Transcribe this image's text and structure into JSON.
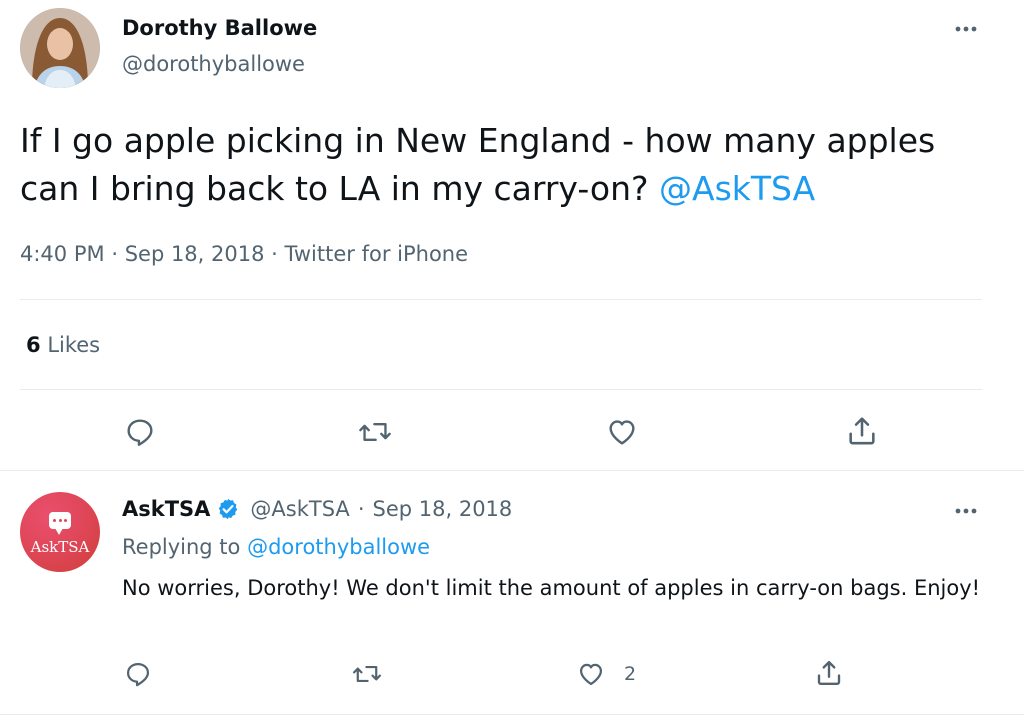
{
  "tweet": {
    "author_name": "Dorothy Ballowe",
    "author_handle": "@dorothyballowe",
    "text": "If I go apple picking in New England - how many apples can I bring back to LA in my carry-on?",
    "mention": "@AskTSA",
    "time": "4:40 PM",
    "date": "Sep 18, 2018",
    "source": "Twitter for iPhone",
    "likes_count": "6",
    "likes_label": "Likes"
  },
  "reply": {
    "author_name": "AskTSA",
    "author_handle": "@AskTSA",
    "date": "Sep 18, 2018",
    "replying_to_label": "Replying to",
    "replying_to_handle": "@dorothyballowe",
    "text": "No worries, Dorothy! We don't limit the amount of apples in carry-on bags. Enjoy!",
    "like_count": "2",
    "avatar_text": "AskTSA"
  },
  "separators": {
    "dot": "·"
  },
  "colors": {
    "link": "#1d9bf0",
    "muted": "#536471",
    "verified": "#1d9bf0",
    "tsa_red": "#e0475a"
  },
  "icons": [
    "more-icon",
    "reply-icon",
    "retweet-icon",
    "like-icon",
    "share-icon",
    "verified-icon",
    "chat-bubble-icon"
  ]
}
